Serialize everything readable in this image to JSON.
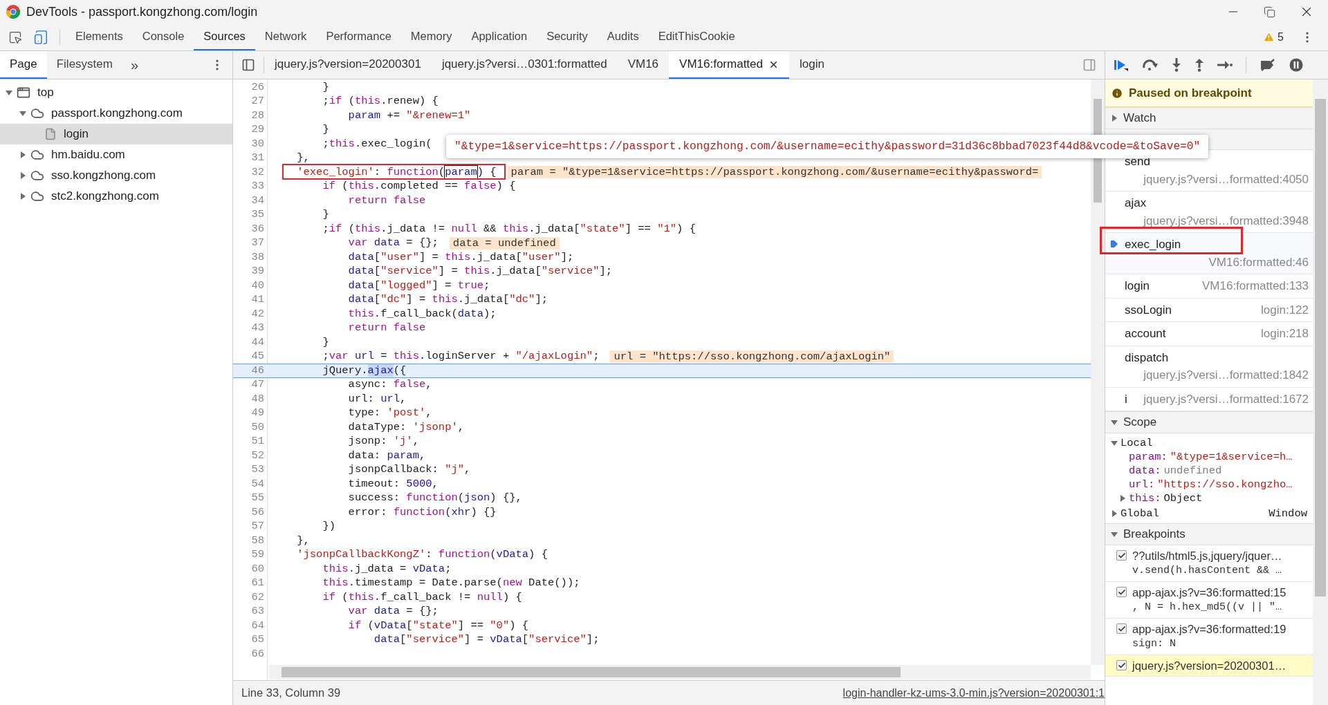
{
  "window": {
    "title": "DevTools - passport.kongzhong.com/login"
  },
  "toolbar": {
    "tabs": [
      {
        "label": "Elements",
        "selected": false
      },
      {
        "label": "Console",
        "selected": false
      },
      {
        "label": "Sources",
        "selected": true
      },
      {
        "label": "Network",
        "selected": false
      },
      {
        "label": "Performance",
        "selected": false
      },
      {
        "label": "Memory",
        "selected": false
      },
      {
        "label": "Application",
        "selected": false
      },
      {
        "label": "Security",
        "selected": false
      },
      {
        "label": "Audits",
        "selected": false
      },
      {
        "label": "EditThisCookie",
        "selected": false
      }
    ],
    "warnings": "5"
  },
  "navigator": {
    "tabs": [
      {
        "label": "Page",
        "selected": true
      },
      {
        "label": "Filesystem",
        "selected": false
      }
    ],
    "more": "»",
    "tree": [
      {
        "label": "top",
        "kind": "frame",
        "expanded": true,
        "selected": false,
        "children": [
          {
            "label": "passport.kongzhong.com",
            "kind": "domain",
            "expanded": true,
            "selected": false,
            "children": [
              {
                "label": "login",
                "kind": "file",
                "selected": true
              }
            ]
          },
          {
            "label": "hm.baidu.com",
            "kind": "domain",
            "expanded": false,
            "selected": false
          },
          {
            "label": "sso.kongzhong.com",
            "kind": "domain",
            "expanded": false,
            "selected": false
          },
          {
            "label": "stc2.kongzhong.com",
            "kind": "domain",
            "expanded": false,
            "selected": false
          }
        ]
      }
    ]
  },
  "editor": {
    "tabs": [
      {
        "label": "jquery.js?version=20200301",
        "selected": false,
        "closable": false
      },
      {
        "label": "jquery.js?versi…0301:formatted",
        "selected": false,
        "closable": false
      },
      {
        "label": "VM16",
        "selected": false,
        "closable": false
      },
      {
        "label": "VM16:formatted",
        "selected": true,
        "closable": true
      },
      {
        "label": "login",
        "selected": false,
        "closable": false
      }
    ],
    "lines": [
      {
        "n": "26",
        "current": false,
        "t": [
          {
            "kind": "plain",
            "text": "        }"
          }
        ]
      },
      {
        "n": "27",
        "current": false,
        "t": [
          {
            "kind": "plain",
            "text": "        ;"
          },
          {
            "kind": "keyword",
            "text": "if"
          },
          {
            "kind": "plain",
            "text": " ("
          },
          {
            "kind": "keyword",
            "text": "this"
          },
          {
            "kind": "plain",
            "text": ".renew) {"
          }
        ]
      },
      {
        "n": "28",
        "current": false,
        "t": [
          {
            "kind": "variable",
            "text": "            param"
          },
          {
            "kind": "plain",
            "text": " += "
          },
          {
            "kind": "string",
            "text": "\"&renew=1\""
          }
        ]
      },
      {
        "n": "29",
        "current": false,
        "t": [
          {
            "kind": "plain",
            "text": "        }"
          }
        ]
      },
      {
        "n": "30",
        "current": false,
        "t": [
          {
            "kind": "plain",
            "text": "        ;"
          },
          {
            "kind": "keyword",
            "text": "this"
          },
          {
            "kind": "plain",
            "text": ".exec_login("
          }
        ]
      },
      {
        "n": "31",
        "current": false,
        "t": [
          {
            "kind": "plain",
            "text": "    },"
          }
        ]
      },
      {
        "n": "32",
        "current": false,
        "t": [
          {
            "kind": "string",
            "text": "    'exec_login'"
          },
          {
            "kind": "plain",
            "text": ": "
          },
          {
            "kind": "keyword",
            "text": "function"
          },
          {
            "kind": "plain",
            "text": "("
          },
          {
            "kind": "hover",
            "text": "param"
          },
          {
            "kind": "plain",
            "text": ") {"
          }
        ],
        "inline": "param = \"&type=1&service=https://passport.kongzhong.com/&username=ecithy&password="
      },
      {
        "n": "33",
        "current": false,
        "t": [
          {
            "kind": "keyword",
            "text": "        if"
          },
          {
            "kind": "plain",
            "text": " ("
          },
          {
            "kind": "keyword",
            "text": "this"
          },
          {
            "kind": "plain",
            "text": ".completed == "
          },
          {
            "kind": "keyword",
            "text": "false"
          },
          {
            "kind": "plain",
            "text": ") {"
          }
        ]
      },
      {
        "n": "34",
        "current": false,
        "t": [
          {
            "kind": "keyword",
            "text": "            return false"
          }
        ]
      },
      {
        "n": "35",
        "current": false,
        "t": [
          {
            "kind": "plain",
            "text": "        }"
          }
        ]
      },
      {
        "n": "36",
        "current": false,
        "t": [
          {
            "kind": "plain",
            "text": "        ;"
          },
          {
            "kind": "keyword",
            "text": "if"
          },
          {
            "kind": "plain",
            "text": " ("
          },
          {
            "kind": "keyword",
            "text": "this"
          },
          {
            "kind": "plain",
            "text": ".j_data != "
          },
          {
            "kind": "keyword",
            "text": "null"
          },
          {
            "kind": "plain",
            "text": " && "
          },
          {
            "kind": "keyword",
            "text": "this"
          },
          {
            "kind": "plain",
            "text": ".j_data["
          },
          {
            "kind": "string",
            "text": "\"state\""
          },
          {
            "kind": "plain",
            "text": "] == "
          },
          {
            "kind": "string",
            "text": "\"1\""
          },
          {
            "kind": "plain",
            "text": ") {"
          }
        ]
      },
      {
        "n": "37",
        "current": false,
        "t": [
          {
            "kind": "keyword",
            "text": "            var"
          },
          {
            "kind": "variable",
            "text": " data"
          },
          {
            "kind": "plain",
            "text": " = {};"
          }
        ],
        "inline": "data = undefined"
      },
      {
        "n": "38",
        "current": false,
        "t": [
          {
            "kind": "variable",
            "text": "            data"
          },
          {
            "kind": "plain",
            "text": "["
          },
          {
            "kind": "string",
            "text": "\"user\""
          },
          {
            "kind": "plain",
            "text": "] = "
          },
          {
            "kind": "keyword",
            "text": "this"
          },
          {
            "kind": "plain",
            "text": ".j_data["
          },
          {
            "kind": "string",
            "text": "\"user\""
          },
          {
            "kind": "plain",
            "text": "];"
          }
        ]
      },
      {
        "n": "39",
        "current": false,
        "t": [
          {
            "kind": "variable",
            "text": "            data"
          },
          {
            "kind": "plain",
            "text": "["
          },
          {
            "kind": "string",
            "text": "\"service\""
          },
          {
            "kind": "plain",
            "text": "] = "
          },
          {
            "kind": "keyword",
            "text": "this"
          },
          {
            "kind": "plain",
            "text": ".j_data["
          },
          {
            "kind": "string",
            "text": "\"service\""
          },
          {
            "kind": "plain",
            "text": "];"
          }
        ]
      },
      {
        "n": "40",
        "current": false,
        "t": [
          {
            "kind": "variable",
            "text": "            data"
          },
          {
            "kind": "plain",
            "text": "["
          },
          {
            "kind": "string",
            "text": "\"logged\""
          },
          {
            "kind": "plain",
            "text": "] = "
          },
          {
            "kind": "keyword",
            "text": "true"
          },
          {
            "kind": "plain",
            "text": ";"
          }
        ]
      },
      {
        "n": "41",
        "current": false,
        "t": [
          {
            "kind": "variable",
            "text": "            data"
          },
          {
            "kind": "plain",
            "text": "["
          },
          {
            "kind": "string",
            "text": "\"dc\""
          },
          {
            "kind": "plain",
            "text": "] = "
          },
          {
            "kind": "keyword",
            "text": "this"
          },
          {
            "kind": "plain",
            "text": ".j_data["
          },
          {
            "kind": "string",
            "text": "\"dc\""
          },
          {
            "kind": "plain",
            "text": "];"
          }
        ]
      },
      {
        "n": "42",
        "current": false,
        "t": [
          {
            "kind": "keyword",
            "text": "            this"
          },
          {
            "kind": "plain",
            "text": ".f_call_back("
          },
          {
            "kind": "variable",
            "text": "data"
          },
          {
            "kind": "plain",
            "text": ");"
          }
        ]
      },
      {
        "n": "43",
        "current": false,
        "t": [
          {
            "kind": "keyword",
            "text": "            return false"
          }
        ]
      },
      {
        "n": "44",
        "current": false,
        "t": [
          {
            "kind": "plain",
            "text": "        }"
          }
        ]
      },
      {
        "n": "45",
        "current": false,
        "t": [
          {
            "kind": "plain",
            "text": "        ;"
          },
          {
            "kind": "keyword",
            "text": "var"
          },
          {
            "kind": "variable",
            "text": " url"
          },
          {
            "kind": "plain",
            "text": " = "
          },
          {
            "kind": "keyword",
            "text": "this"
          },
          {
            "kind": "plain",
            "text": ".loginServer + "
          },
          {
            "kind": "string",
            "text": "\"/ajaxLogin\""
          },
          {
            "kind": "plain",
            "text": ";"
          }
        ],
        "inline": "url = \"https://sso.kongzhong.com/ajaxLogin\""
      },
      {
        "n": "46",
        "current": true,
        "t": [
          {
            "kind": "plain",
            "text": "        jQuery."
          },
          {
            "kind": "match",
            "text": "ajax"
          },
          {
            "kind": "plain",
            "text": "({"
          }
        ]
      },
      {
        "n": "47",
        "current": false,
        "t": [
          {
            "kind": "plain",
            "text": "            async: "
          },
          {
            "kind": "keyword",
            "text": "false"
          },
          {
            "kind": "plain",
            "text": ","
          }
        ]
      },
      {
        "n": "48",
        "current": false,
        "t": [
          {
            "kind": "plain",
            "text": "            url: "
          },
          {
            "kind": "variable",
            "text": "url"
          },
          {
            "kind": "plain",
            "text": ","
          }
        ]
      },
      {
        "n": "49",
        "current": false,
        "t": [
          {
            "kind": "plain",
            "text": "            type: "
          },
          {
            "kind": "string",
            "text": "'post'"
          },
          {
            "kind": "plain",
            "text": ","
          }
        ]
      },
      {
        "n": "50",
        "current": false,
        "t": [
          {
            "kind": "plain",
            "text": "            dataType: "
          },
          {
            "kind": "string",
            "text": "'jsonp'"
          },
          {
            "kind": "plain",
            "text": ","
          }
        ]
      },
      {
        "n": "51",
        "current": false,
        "t": [
          {
            "kind": "plain",
            "text": "            jsonp: "
          },
          {
            "kind": "string",
            "text": "'j'"
          },
          {
            "kind": "plain",
            "text": ","
          }
        ]
      },
      {
        "n": "52",
        "current": false,
        "t": [
          {
            "kind": "plain",
            "text": "            data: "
          },
          {
            "kind": "variable",
            "text": "param"
          },
          {
            "kind": "plain",
            "text": ","
          }
        ]
      },
      {
        "n": "53",
        "current": false,
        "t": [
          {
            "kind": "plain",
            "text": "            jsonpCallback: "
          },
          {
            "kind": "string",
            "text": "\"j\""
          },
          {
            "kind": "plain",
            "text": ","
          }
        ]
      },
      {
        "n": "54",
        "current": false,
        "t": [
          {
            "kind": "plain",
            "text": "            timeout: "
          },
          {
            "kind": "number",
            "text": "5000"
          },
          {
            "kind": "plain",
            "text": ","
          }
        ]
      },
      {
        "n": "55",
        "current": false,
        "t": [
          {
            "kind": "plain",
            "text": "            success: "
          },
          {
            "kind": "keyword",
            "text": "function"
          },
          {
            "kind": "plain",
            "text": "("
          },
          {
            "kind": "variable",
            "text": "json"
          },
          {
            "kind": "plain",
            "text": ") {},"
          }
        ]
      },
      {
        "n": "56",
        "current": false,
        "t": [
          {
            "kind": "plain",
            "text": "            error: "
          },
          {
            "kind": "keyword",
            "text": "function"
          },
          {
            "kind": "plain",
            "text": "("
          },
          {
            "kind": "variable",
            "text": "xhr"
          },
          {
            "kind": "plain",
            "text": ") {}"
          }
        ]
      },
      {
        "n": "57",
        "current": false,
        "t": [
          {
            "kind": "plain",
            "text": "        })"
          }
        ]
      },
      {
        "n": "58",
        "current": false,
        "t": [
          {
            "kind": "plain",
            "text": "    },"
          }
        ]
      },
      {
        "n": "59",
        "current": false,
        "t": [
          {
            "kind": "string",
            "text": "    'jsonpCallbackKongZ'"
          },
          {
            "kind": "plain",
            "text": ": "
          },
          {
            "kind": "keyword",
            "text": "function"
          },
          {
            "kind": "plain",
            "text": "("
          },
          {
            "kind": "variable",
            "text": "vData"
          },
          {
            "kind": "plain",
            "text": ") {"
          }
        ]
      },
      {
        "n": "60",
        "current": false,
        "t": [
          {
            "kind": "keyword",
            "text": "        this"
          },
          {
            "kind": "plain",
            "text": ".j_data = "
          },
          {
            "kind": "variable",
            "text": "vData"
          },
          {
            "kind": "plain",
            "text": ";"
          }
        ]
      },
      {
        "n": "61",
        "current": false,
        "t": [
          {
            "kind": "keyword",
            "text": "        this"
          },
          {
            "kind": "plain",
            "text": ".timestamp = Date.parse("
          },
          {
            "kind": "keyword",
            "text": "new"
          },
          {
            "kind": "plain",
            "text": " Date());"
          }
        ]
      },
      {
        "n": "62",
        "current": false,
        "t": [
          {
            "kind": "keyword",
            "text": "        if"
          },
          {
            "kind": "plain",
            "text": " ("
          },
          {
            "kind": "keyword",
            "text": "this"
          },
          {
            "kind": "plain",
            "text": ".f_call_back != "
          },
          {
            "kind": "keyword",
            "text": "null"
          },
          {
            "kind": "plain",
            "text": ") {"
          }
        ]
      },
      {
        "n": "63",
        "current": false,
        "t": [
          {
            "kind": "keyword",
            "text": "            var"
          },
          {
            "kind": "variable",
            "text": " data"
          },
          {
            "kind": "plain",
            "text": " = {};"
          }
        ]
      },
      {
        "n": "64",
        "current": false,
        "t": [
          {
            "kind": "keyword",
            "text": "            if"
          },
          {
            "kind": "plain",
            "text": " ("
          },
          {
            "kind": "variable",
            "text": "vData"
          },
          {
            "kind": "plain",
            "text": "["
          },
          {
            "kind": "string",
            "text": "\"state\""
          },
          {
            "kind": "plain",
            "text": "] == "
          },
          {
            "kind": "string",
            "text": "\"0\""
          },
          {
            "kind": "plain",
            "text": ") {"
          }
        ]
      },
      {
        "n": "65",
        "current": false,
        "t": [
          {
            "kind": "variable",
            "text": "                data"
          },
          {
            "kind": "plain",
            "text": "["
          },
          {
            "kind": "string",
            "text": "\"service\""
          },
          {
            "kind": "plain",
            "text": "] = "
          },
          {
            "kind": "variable",
            "text": "vData"
          },
          {
            "kind": "plain",
            "text": "["
          },
          {
            "kind": "string",
            "text": "\"service\""
          },
          {
            "kind": "plain",
            "text": "];"
          }
        ]
      },
      {
        "n": "66",
        "current": false
      }
    ],
    "tooltip": "\"&type=1&service=https://passport.kongzhong.com/&username=ecithy&password=31d36c8bbad7023f44d8&vcode=&toSave=0\""
  },
  "status_bar": {
    "position": "Line 33, Column 39",
    "source_link": "login-handler-kz-ums-3.0-min.js?version=20200301:1"
  },
  "debugger": {
    "paused": "Paused on breakpoint",
    "watch": {
      "label": "Watch",
      "expanded": false
    },
    "call_stack": [
      {
        "name": "send",
        "location": "jquery.js?versi…formatted:4050",
        "selected": false
      },
      {
        "name": "ajax",
        "location": "jquery.js?versi…formatted:3948",
        "selected": false
      },
      {
        "name": "exec_login",
        "location": "VM16:formatted:46",
        "selected": true
      },
      {
        "name": "login",
        "location": "VM16:formatted:133",
        "selected": false
      },
      {
        "name": "ssoLogin",
        "location": "login:122",
        "selected": false
      },
      {
        "name": "account",
        "location": "login:218",
        "selected": false
      },
      {
        "name": "dispatch",
        "location": "jquery.js?versi…formatted:1842",
        "selected": false
      },
      {
        "name": "i",
        "location": "jquery.js?versi…formatted:1672",
        "selected": false
      }
    ],
    "scope": {
      "label": "Scope",
      "expanded": true,
      "local": {
        "label": "Local",
        "expanded": true,
        "vars": [
          {
            "name": "param:",
            "value": "\"&type=1&service=h…",
            "kind": "string"
          },
          {
            "name": "data:",
            "value": "undefined",
            "kind": "undefined"
          },
          {
            "name": "url:",
            "value": "\"https://sso.kongzho…",
            "kind": "string"
          },
          {
            "name": "this:",
            "value": "Object",
            "kind": "object",
            "expanded": false
          }
        ]
      },
      "global": {
        "label": "Global",
        "value": "Window",
        "expanded": false
      }
    },
    "breakpoints": {
      "label": "Breakpoints",
      "expanded": true,
      "items": [
        {
          "file": "??utils/html5.js,jquery/jquer…",
          "snippet": "v.send(h.hasContent && …",
          "checked": true,
          "selected": false
        },
        {
          "file": "app-ajax.js?v=36:formatted:15",
          "snippet": ", N = h.hex_md5((v || \"…",
          "checked": true,
          "selected": false
        },
        {
          "file": "app-ajax.js?v=36:formatted:19",
          "snippet": "sign: N",
          "checked": true,
          "selected": false
        },
        {
          "file": "jquery.js?version=20200301…",
          "checked": true,
          "selected": true
        }
      ]
    }
  }
}
